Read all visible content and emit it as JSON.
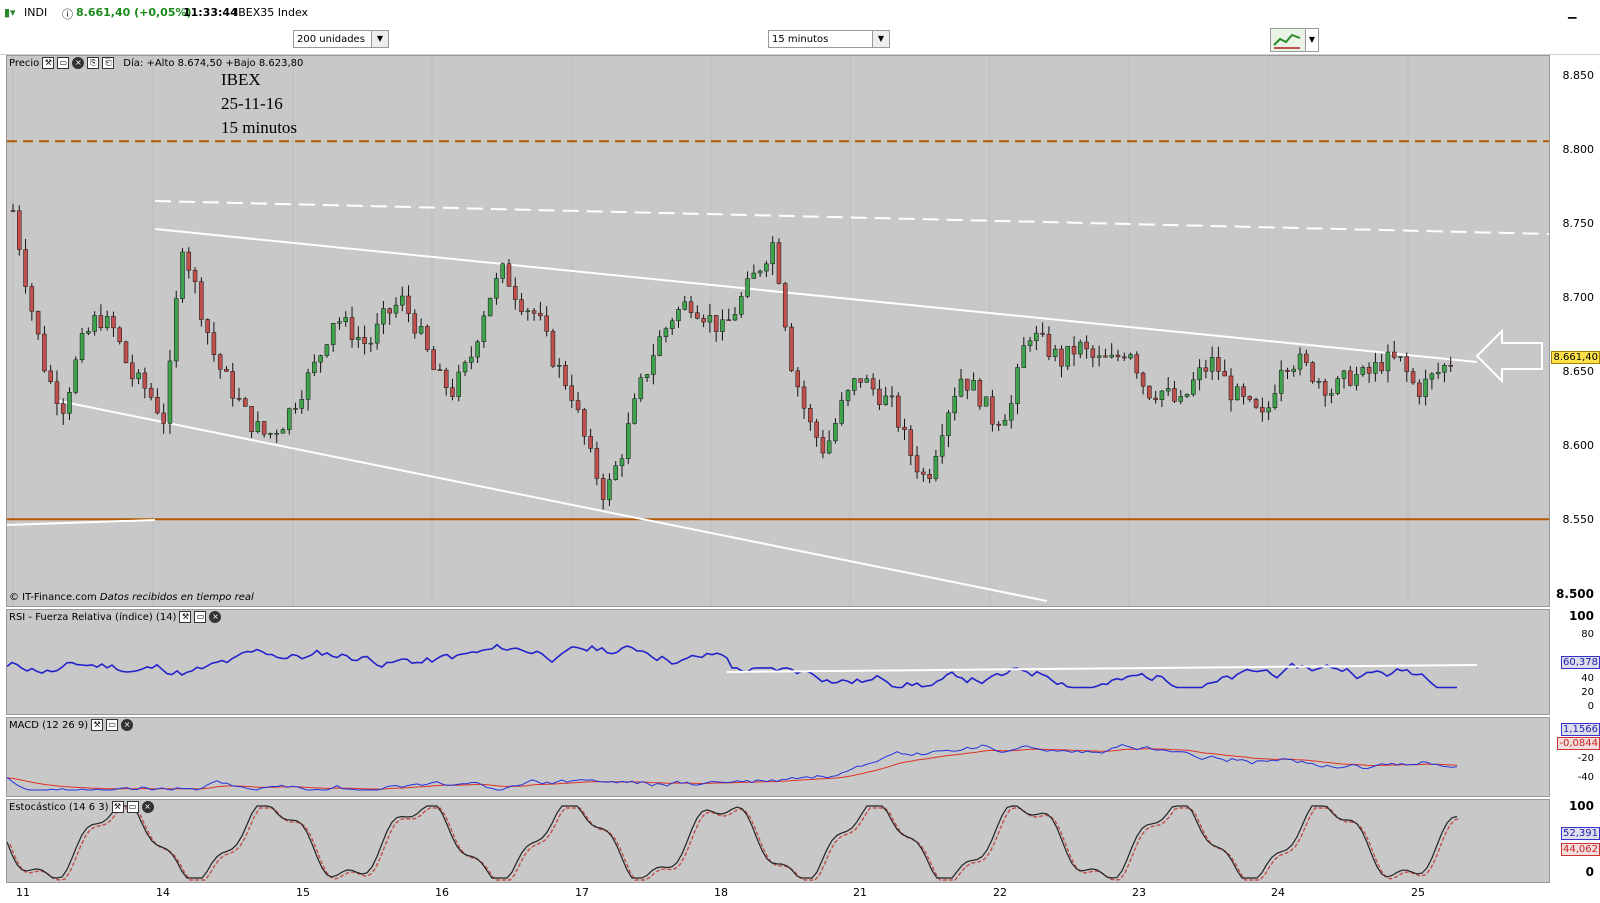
{
  "titlebar": {
    "symbol": "INDI",
    "price": "8.661,40 (+0,05%)",
    "time": "11:33:44",
    "name": "IBEX35 Index"
  },
  "toolbar": {
    "units": "200 unidades",
    "interval": "15 minutos"
  },
  "price_panel": {
    "label": "Precio",
    "day_info": "Día: +Alto 8.674,50 +Bajo 8.623,80",
    "annotation_lines": [
      "IBEX",
      "25-11-16",
      "15 minutos"
    ],
    "copyright": "© IT-Finance.com",
    "realtime": "Datos recibidos en tiempo real",
    "last_price": "8.661,40",
    "y_ticks": [
      "8.850",
      "8.800",
      "8.750",
      "8.700",
      "8.650",
      "8.600",
      "8.550",
      "8.500"
    ]
  },
  "rsi_panel": {
    "label": "RSI - Fuerza Relativa (índice) (14)",
    "value": "60,378",
    "y_ticks": [
      "100",
      "80",
      "60",
      "40",
      "20",
      "0"
    ]
  },
  "macd_panel": {
    "label": "MACD (12 26 9)",
    "value1": "1,1566",
    "value2": "-0,0844",
    "y_ticks": [
      "-20",
      "-40"
    ]
  },
  "stoch_panel": {
    "label": "Estocástico (14 6 3)",
    "value1": "52,391",
    "value2": "44,062",
    "y_ticks": [
      "100",
      "0"
    ]
  },
  "x_labels": [
    "11",
    "14",
    "15",
    "16",
    "17",
    "18",
    "21",
    "22",
    "23",
    "24",
    "25"
  ],
  "colors": {
    "up": "#3fa34d",
    "down": "#c0504d",
    "rsi": "#2222cc",
    "macd": "#2233dd",
    "signal": "#dd3322",
    "support": "#b25a00"
  },
  "chart_data": {
    "type": "candlestick",
    "x_categories": [
      "11",
      "14",
      "15",
      "16",
      "17",
      "18",
      "21",
      "22",
      "23",
      "24",
      "25"
    ],
    "ylim": [
      8500,
      8860
    ],
    "close_path": [
      8760,
      8700,
      8650,
      8630,
      8670,
      8690,
      8680,
      8650,
      8640,
      8620,
      8740,
      8700,
      8660,
      8640,
      8620,
      8610,
      8620,
      8640,
      8660,
      8690,
      8680,
      8670,
      8690,
      8700,
      8680,
      8650,
      8640,
      8660,
      8700,
      8720,
      8700,
      8690,
      8660,
      8640,
      8600,
      8570,
      8600,
      8640,
      8670,
      8690,
      8700,
      8690,
      8680,
      8700,
      8720,
      8740,
      8660,
      8620,
      8600,
      8630,
      8650,
      8640,
      8630,
      8600,
      8580,
      8620,
      8650,
      8640,
      8620,
      8630,
      8680,
      8670,
      8660,
      8670,
      8660,
      8660,
      8670,
      8640,
      8640,
      8630,
      8650,
      8660,
      8640,
      8630,
      8620,
      8660,
      8660,
      8650,
      8640,
      8650,
      8650,
      8660,
      8660,
      8640,
      8650,
      8660
    ],
    "horizontal_lines": [
      8806,
      8555
    ],
    "last": 8661.4
  }
}
